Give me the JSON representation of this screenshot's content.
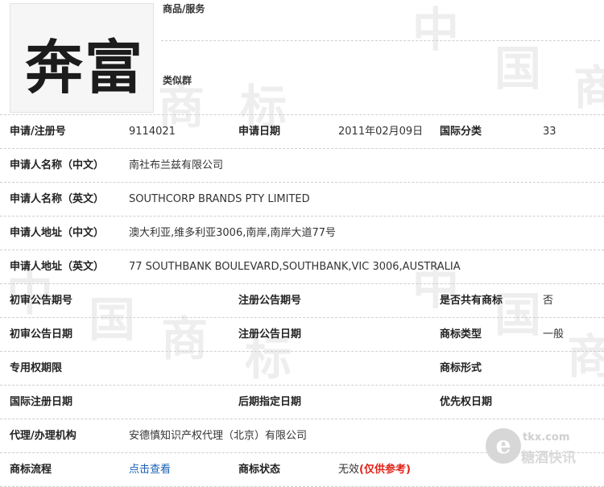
{
  "logo_text": "奔富",
  "header": {
    "goods_label": "商品/服务",
    "similar_label": "类似群"
  },
  "watermark_chars": [
    "中",
    "国",
    "商",
    "标"
  ],
  "fields": {
    "reg_no_label": "申请/注册号",
    "reg_no": "9114021",
    "apply_date_label": "申请日期",
    "apply_date": "2011年02月09日",
    "intl_class_label": "国际分类",
    "intl_class": "33",
    "name_cn_label": "申请人名称（中文）",
    "name_cn": "南社布兰兹有限公司",
    "name_en_label": "申请人名称（英文）",
    "name_en": "SOUTHCORP BRANDS PTY LIMITED",
    "addr_cn_label": "申请人地址（中文）",
    "addr_cn": "澳大利亚,维多利亚3006,南岸,南岸大道77号",
    "addr_en_label": "申请人地址（英文）",
    "addr_en": "77 SOUTHBANK BOULEVARD,SOUTHBANK,VIC 3006,AUSTRALIA",
    "prelim_no_label": "初审公告期号",
    "reg_pub_no_label": "注册公告期号",
    "shared_label": "是否共有商标",
    "shared": "否",
    "prelim_date_label": "初审公告日期",
    "reg_pub_date_label": "注册公告日期",
    "type_label": "商标类型",
    "type": "一般",
    "exclusive_label": "专用权期限",
    "form_label": "商标形式",
    "intl_reg_date_label": "国际注册日期",
    "later_date_label": "后期指定日期",
    "priority_label": "优先权日期",
    "agent_label": "代理/办理机构",
    "agent": "安德慎知识产权代理（北京）有限公司",
    "flow_label": "商标流程",
    "flow_link": "点击查看",
    "status_label": "商标状态",
    "status": "无效",
    "status_note": "(仅供参考)"
  },
  "badge": {
    "letter": "e",
    "url": "tkx.com",
    "name": "糖酒快讯"
  }
}
